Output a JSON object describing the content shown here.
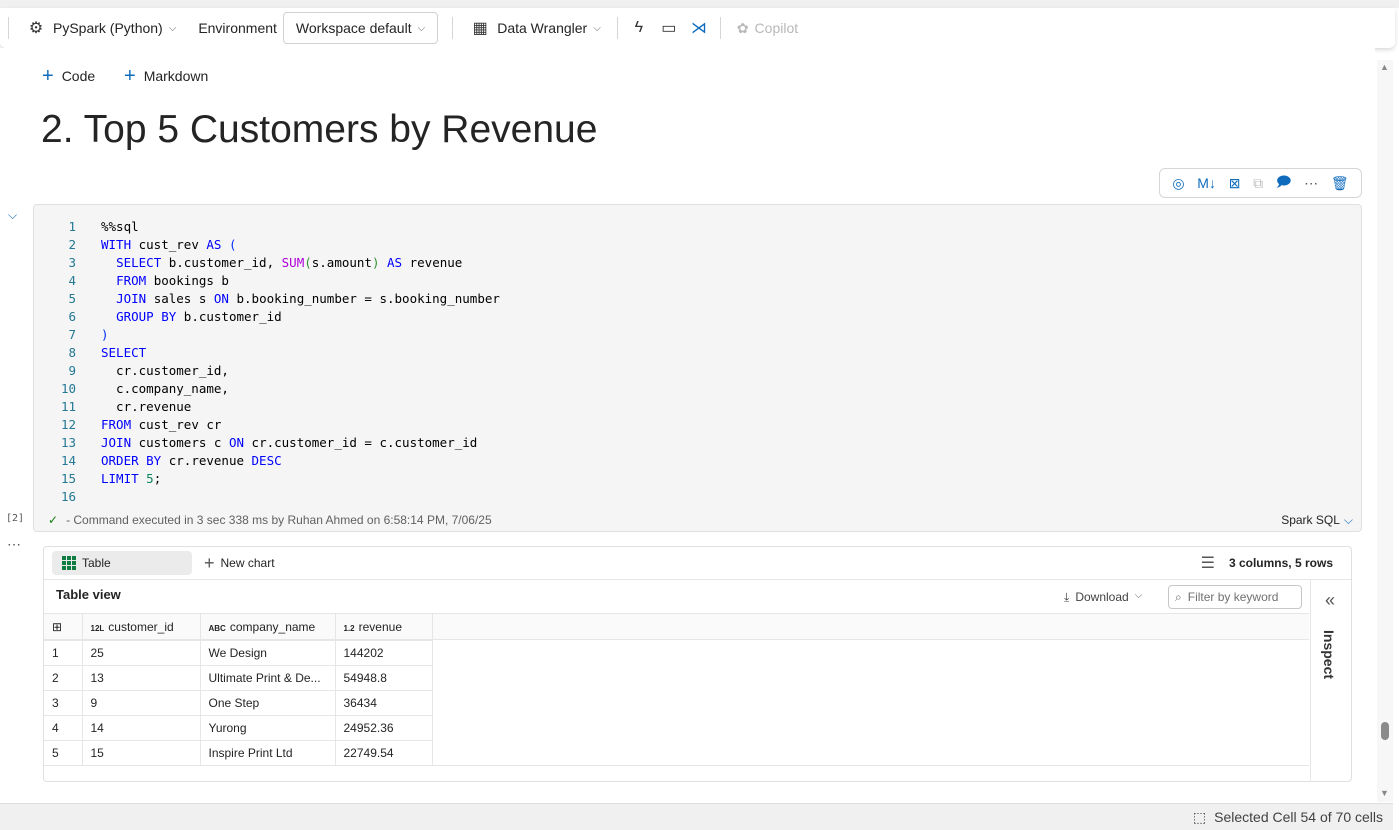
{
  "toolbar": {
    "kernel": "PySpark (Python)",
    "environment": "Environment",
    "workspace": "Workspace default",
    "data_wrangler": "Data Wrangler",
    "copilot": "Copilot"
  },
  "add": {
    "code": "Code",
    "markdown": "Markdown"
  },
  "heading": "2. Top 5 Customers by Revenue",
  "cell_toolbar": {
    "markdown": "M↓"
  },
  "code_lines": [
    [
      [
        "%%sql",
        "t"
      ]
    ],
    [
      [
        "WITH",
        "k"
      ],
      [
        " cust_rev ",
        "t"
      ],
      [
        "AS",
        "k"
      ],
      [
        " (",
        "pk"
      ]
    ],
    [
      [
        "  ",
        "t"
      ],
      [
        "SELECT",
        "k"
      ],
      [
        " b.customer_id, ",
        "t"
      ],
      [
        "SUM",
        "f"
      ],
      [
        "(",
        "p"
      ],
      [
        "s.amount",
        "t"
      ],
      [
        ")",
        "p"
      ],
      [
        " ",
        "t"
      ],
      [
        "AS",
        "k"
      ],
      [
        " revenue",
        "t"
      ]
    ],
    [
      [
        "  ",
        "t"
      ],
      [
        "FROM",
        "k"
      ],
      [
        " bookings b",
        "t"
      ]
    ],
    [
      [
        "  ",
        "t"
      ],
      [
        "JOIN",
        "k"
      ],
      [
        " sales s ",
        "t"
      ],
      [
        "ON",
        "k"
      ],
      [
        " b.booking_number = s.booking_number",
        "t"
      ]
    ],
    [
      [
        "  ",
        "t"
      ],
      [
        "GROUP BY",
        "k"
      ],
      [
        " b.customer_id",
        "t"
      ]
    ],
    [
      [
        ")",
        "pk"
      ]
    ],
    [
      [
        "SELECT",
        "k"
      ]
    ],
    [
      [
        "  cr.customer_id,",
        "t"
      ]
    ],
    [
      [
        "  c.company_name,",
        "t"
      ]
    ],
    [
      [
        "  cr.revenue",
        "t"
      ]
    ],
    [
      [
        "FROM",
        "k"
      ],
      [
        " cust_rev cr",
        "t"
      ]
    ],
    [
      [
        "JOIN",
        "k"
      ],
      [
        " customers c ",
        "t"
      ],
      [
        "ON",
        "k"
      ],
      [
        " cr.customer_id = c.customer_id",
        "t"
      ]
    ],
    [
      [
        "ORDER BY",
        "k"
      ],
      [
        " cr.revenue ",
        "t"
      ],
      [
        "DESC",
        "k"
      ]
    ],
    [
      [
        "LIMIT",
        "k"
      ],
      [
        " ",
        "t"
      ],
      [
        "5",
        "n"
      ],
      [
        ";",
        "t"
      ]
    ],
    [
      [
        "",
        "t"
      ]
    ]
  ],
  "execution": {
    "count": "[2]",
    "status": "- Command executed in 3 sec 338 ms by Ruhan Ahmed on 6:58:14 PM, 7/06/25",
    "language": "Spark SQL"
  },
  "output": {
    "tab_table": "Table",
    "new_chart": "New chart",
    "summary": "3 columns, 5 rows",
    "title": "Table view",
    "download": "Download",
    "filter_placeholder": "Filter by keyword",
    "inspect": "Inspect",
    "columns": [
      {
        "type": "12L",
        "name": "customer_id"
      },
      {
        "type": "ABC",
        "name": "company_name"
      },
      {
        "type": "1.2",
        "name": "revenue"
      }
    ],
    "rows": [
      [
        "1",
        "25",
        "We Design",
        "144202"
      ],
      [
        "2",
        "13",
        "Ultimate Print & De...",
        "54948.8"
      ],
      [
        "3",
        "9",
        "One Step",
        "36434"
      ],
      [
        "4",
        "14",
        "Yurong",
        "24952.36"
      ],
      [
        "5",
        "15",
        "Inspire Print Ltd",
        "22749.54"
      ]
    ]
  },
  "statusbar": {
    "selection": "Selected Cell 54 of 70 cells"
  }
}
